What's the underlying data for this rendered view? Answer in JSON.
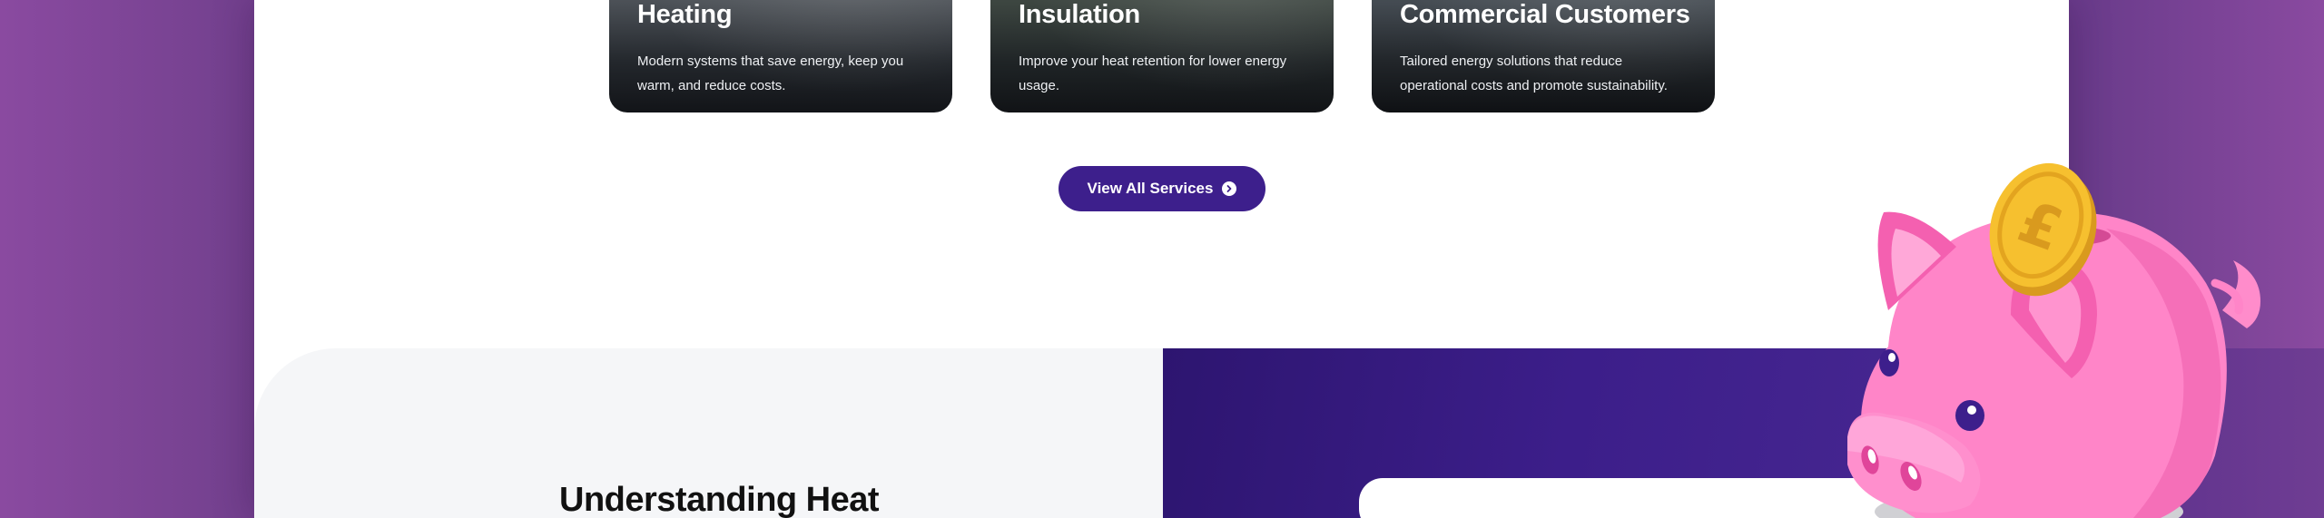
{
  "services": [
    {
      "title": "Heating",
      "description": "Modern systems that save energy, keep you warm, and reduce costs."
    },
    {
      "title": "Insulation",
      "description": "Improve your heat retention for lower energy usage."
    },
    {
      "title": "Commercial Customers",
      "description": "Tailored energy solutions that reduce operational costs and promote sustainability."
    }
  ],
  "view_all_button": {
    "label": "View All Services",
    "icon": "arrow-right-circle-icon"
  },
  "section": {
    "heading": "Understanding Heat"
  },
  "illustration": {
    "icon": "piggy-bank-icon",
    "coin_symbol": "£"
  },
  "colors": {
    "brand_purple": "#3d1f8c",
    "pig_pink": "#ff85c8",
    "coin_gold": "#f6c02f",
    "background_purple": "#74418f",
    "panel_grey": "#f5f6f8"
  }
}
